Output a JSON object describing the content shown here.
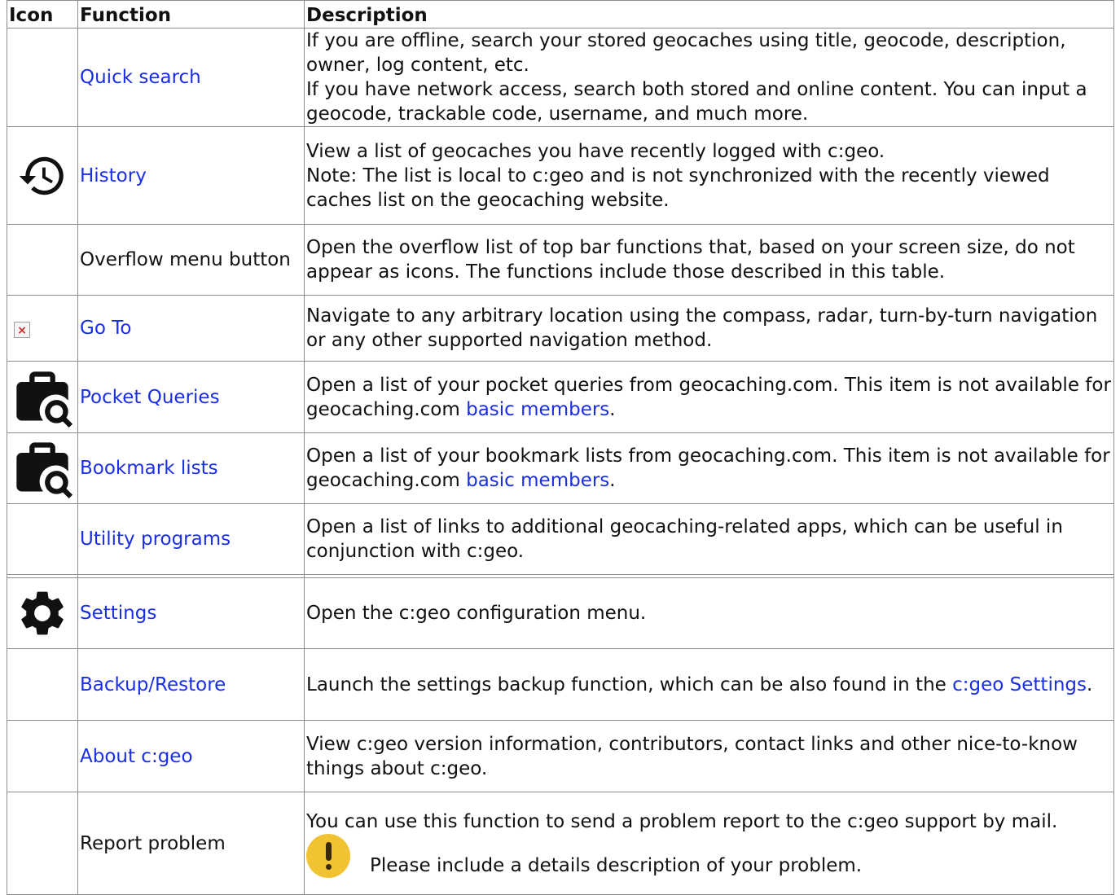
{
  "headers": {
    "icon": "Icon",
    "function": "Function",
    "description": "Description"
  },
  "rows": [
    {
      "icon": "none",
      "function": "Quick search",
      "function_link": true,
      "desc": [
        "If you are offline, search your stored geocaches using title, geocode, description, owner, log content, etc.",
        "If you have network access, search both stored and online content. You can input a geocode, trackable code, username, and much more."
      ]
    },
    {
      "icon": "history-icon",
      "function": "History",
      "function_link": true,
      "desc": [
        "View a list of geocaches you have recently logged with c:geo.",
        "Note: The list is local to c:geo and is not synchronized with the recently viewed caches list on the geocaching website."
      ]
    },
    {
      "icon": "none",
      "function": "Overflow menu button",
      "function_link": false,
      "desc": [
        "Open the overflow list of top bar functions that, based on your screen size, do not appear as icons. The functions include those described in this table."
      ]
    },
    {
      "icon": "broken-image-icon",
      "function": "Go To",
      "function_link": true,
      "desc": [
        "Navigate to any arbitrary location using the compass, radar, turn-by-turn navigation or any other supported navigation method."
      ]
    },
    {
      "icon": "briefcase-search-icon",
      "function": "Pocket Queries",
      "function_link": true,
      "desc_before": "Open a list of your pocket queries from geocaching.com. This item is not available for geocaching.com ",
      "desc_link": "basic members",
      "desc_after": "."
    },
    {
      "icon": "briefcase-search-icon",
      "function": "Bookmark lists",
      "function_link": true,
      "desc_before": "Open a list of your bookmark lists from geocaching.com. This item is not available for geocaching.com ",
      "desc_link": "basic members",
      "desc_after": "."
    },
    {
      "icon": "none",
      "function": "Utility programs",
      "function_link": true,
      "desc": [
        "Open a list of links to additional geocaching-related apps, which can be useful in conjunction with c:geo."
      ]
    },
    {
      "icon": "gear-icon",
      "function": "Settings",
      "function_link": true,
      "desc": [
        "Open the c:geo configuration menu."
      ]
    },
    {
      "icon": "none",
      "function": "Backup/Restore",
      "function_link": true,
      "desc_before": "Launch the settings backup function, which can be also found in the ",
      "desc_link": "c:geo Settings",
      "desc_after": "."
    },
    {
      "icon": "none",
      "function": "About c:geo",
      "function_link": true,
      "desc": [
        "View c:geo version information, contributors, contact links and other nice-to-know things about c:geo."
      ]
    },
    {
      "icon": "none",
      "function": "Report problem",
      "function_link": false,
      "desc": [
        "You can use this function to send a problem report to the c:geo support by mail."
      ],
      "note": "Please include a details description of your problem.",
      "note_icon": "warning-icon"
    }
  ]
}
